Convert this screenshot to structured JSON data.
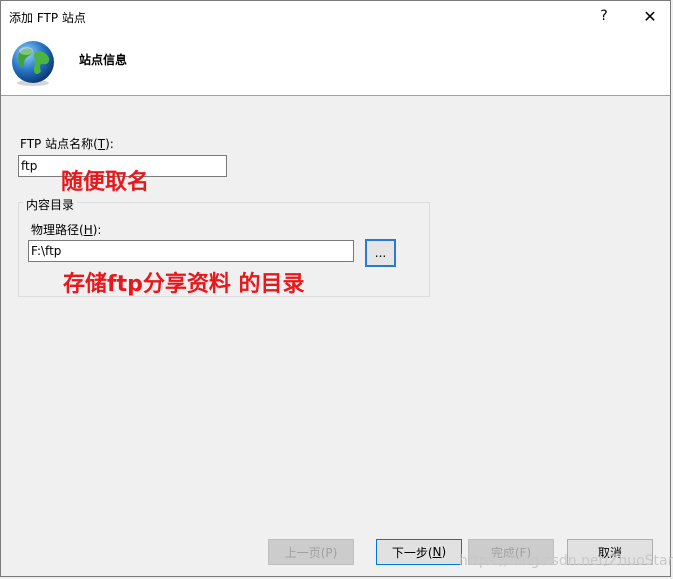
{
  "window": {
    "title": "添加 FTP 站点",
    "help": "?",
    "close": "✕"
  },
  "header": {
    "title": "站点信息",
    "icon": "globe-icon"
  },
  "site_name": {
    "label_pre": "FTP 站点名称(",
    "label_key": "T",
    "label_post": "):",
    "value": "ftp"
  },
  "annotations": {
    "name_note": "随便取名",
    "path_note": "存储ftp分享资料 的目录"
  },
  "content_dir": {
    "legend": "内容目录",
    "path_label_pre": "物理路径(",
    "path_label_key": "H",
    "path_label_post": "):",
    "path_value": "F:\\ftp",
    "browse": "..."
  },
  "footer": {
    "prev": "上一页(P)",
    "next_pre": "下一步(",
    "next_key": "N",
    "next_post": ")",
    "finish": "完成(F)",
    "cancel": "取消"
  },
  "watermark": "https://blog.csdn.net/ZhuoStar",
  "colors": {
    "annotation": "#e8171b",
    "focus": "#2a7ad5"
  }
}
